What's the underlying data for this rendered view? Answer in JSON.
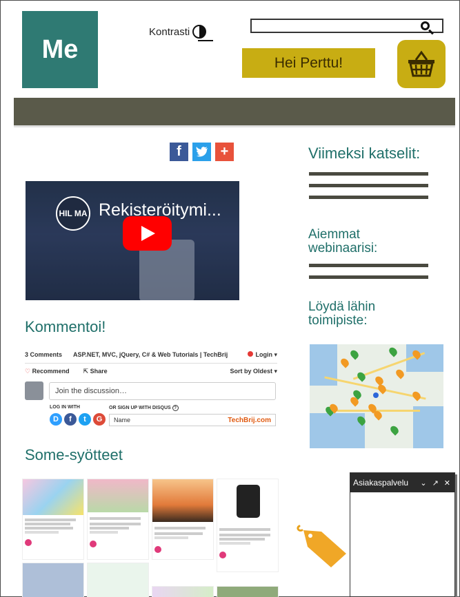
{
  "header": {
    "logo_text": "Me",
    "contrast_label": "Kontrasti",
    "search_placeholder": "",
    "greeting": "Hei Perttu!"
  },
  "social_share": [
    "f",
    "t",
    "+"
  ],
  "video": {
    "channel_badge": "HIL MA",
    "title": "Rekisteröitymi..."
  },
  "comments": {
    "heading": "Kommentoi!",
    "count_label": "3 Comments",
    "site_title": "ASP.NET, MVC, jQuery, C# & Web Tutorials | TechBrij",
    "login": "Login",
    "recommend": "Recommend",
    "share": "Share",
    "sort": "Sort by Oldest",
    "join_placeholder": "Join the discussion…",
    "login_with": "LOG IN WITH",
    "signup_with": "OR SIGN UP WITH DISQUS",
    "name_placeholder": "Name",
    "brand": "TechBrij.com",
    "providers": [
      "D",
      "f",
      "t",
      "G"
    ]
  },
  "feed": {
    "heading": "Some-syötteet"
  },
  "sidebar": {
    "recent_heading": "Viimeksi katselit:",
    "webinars_heading": "Aiemmat webinaarisi:",
    "office_heading": "Löydä lähin toimipiste:"
  },
  "chat": {
    "title": "Asiakaspalvelu"
  },
  "colors": {
    "brand_teal": "#2f7a73",
    "accent_gold": "#c8ad13",
    "nav_dark": "#5a5a4a",
    "heading_teal": "#1f6f69"
  }
}
